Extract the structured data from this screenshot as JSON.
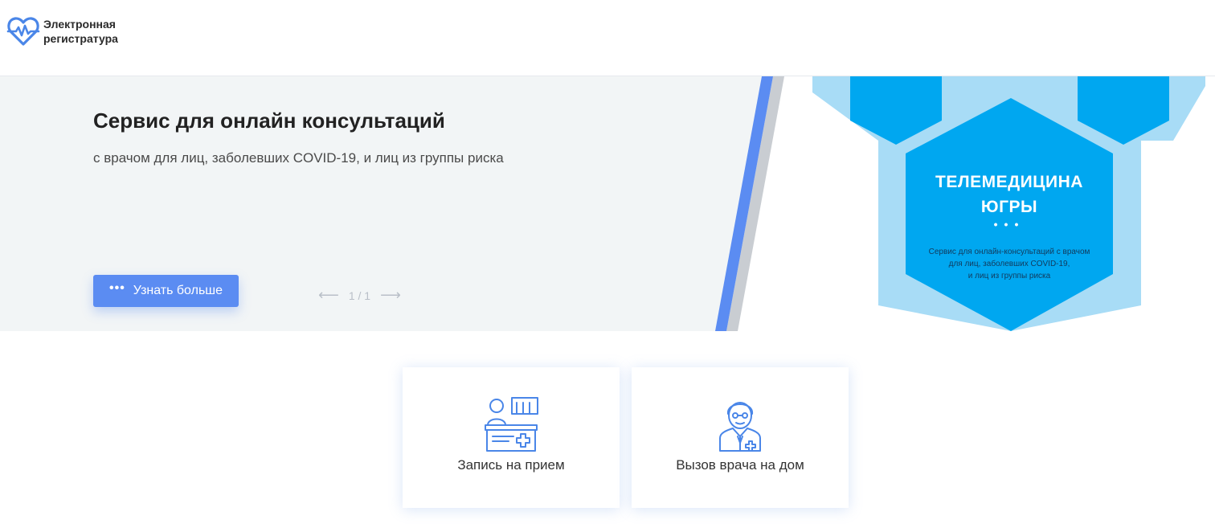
{
  "header": {
    "logo_line1": "Электронная",
    "logo_line2": "регистратура"
  },
  "banner": {
    "title": "Сервис для онлайн консультаций",
    "subtitle": "с врачом для лиц, заболевших COVID-19, и лиц из группы риска",
    "more_button": "Узнать больше",
    "more_button_icon": "ellipsis-icon",
    "pager": {
      "current": "1 / 1",
      "prev_icon": "arrow-left-icon",
      "next_icon": "arrow-right-icon"
    },
    "artwork": {
      "title_line1": "ТЕЛЕМЕДИЦИНА",
      "title_line2": "ЮГРЫ",
      "desc_line1": "Сервис для онлайн-консультаций с врачом",
      "desc_line2": "для лиц, заболевших COVID-19,",
      "desc_line3": "и лиц из группы риска"
    }
  },
  "cards": [
    {
      "label": "Запись на прием",
      "icon": "reception-desk-icon"
    },
    {
      "label": "Вызов врача на дом",
      "icon": "doctor-icon"
    }
  ],
  "colors": {
    "accent": "#5b8cf2",
    "banner_bg": "#f2f5f6",
    "hex_dark": "#00a7f0",
    "hex_light": "#a8dcf6"
  }
}
